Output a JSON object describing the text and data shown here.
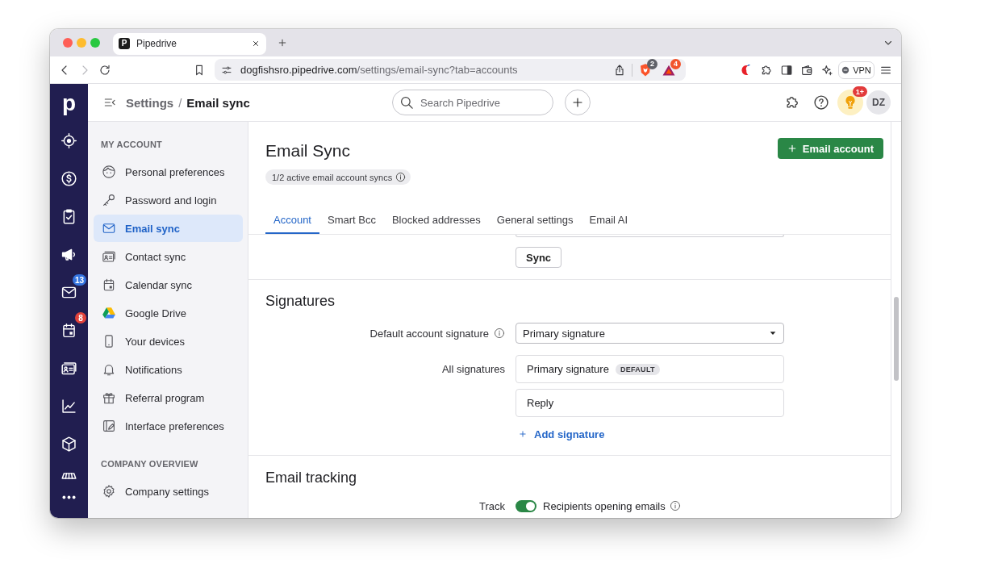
{
  "browser": {
    "tab": {
      "favicon": "P",
      "title": "Pipedrive"
    },
    "nav_buttons": [
      {
        "kind": "back",
        "disabled": false
      },
      {
        "kind": "forward",
        "disabled": true
      },
      {
        "kind": "reload",
        "disabled": false
      }
    ],
    "address": {
      "domain": "dogfishsro.pipedrive.com",
      "path": "/settings/email-sync?tab=accounts"
    },
    "extensions": [
      {
        "kind": "shield",
        "badge": "2",
        "color": "#5f6168"
      },
      {
        "kind": "triangle",
        "badge": "4",
        "color": "#f2542d"
      }
    ],
    "vpn": {
      "label": "VPN"
    }
  },
  "nav": {
    "logo": "p",
    "items": [
      {
        "kind": "target"
      },
      {
        "kind": "dollar"
      },
      {
        "kind": "clipboard"
      },
      {
        "kind": "megaphone"
      },
      {
        "kind": "mail",
        "badge": {
          "text": "13",
          "color": "#3474e0"
        }
      },
      {
        "kind": "calendar",
        "badge": {
          "text": "8",
          "color": "#e2433b"
        }
      },
      {
        "kind": "contacts"
      },
      {
        "kind": "chart"
      },
      {
        "kind": "box"
      }
    ],
    "footer_items": [
      {
        "kind": "store"
      },
      {
        "kind": "more"
      }
    ]
  },
  "header": {
    "breadcrumb": {
      "parent": "Settings",
      "separator": "/",
      "current": "Email sync"
    },
    "search": {
      "placeholder": "Search Pipedrive"
    },
    "tips_badge": "1+",
    "avatar": "DZ"
  },
  "sidebar": {
    "sections": [
      {
        "heading": "MY ACCOUNT",
        "items": [
          {
            "label": "Personal preferences",
            "kind": "face",
            "selected": false
          },
          {
            "label": "Password and login",
            "kind": "key",
            "selected": false
          },
          {
            "label": "Email sync",
            "kind": "mail",
            "selected": true
          },
          {
            "label": "Contact sync",
            "kind": "contacts",
            "selected": false
          },
          {
            "label": "Calendar sync",
            "kind": "calendar",
            "selected": false
          },
          {
            "label": "Google Drive",
            "kind": "drive",
            "selected": false
          },
          {
            "label": "Your devices",
            "kind": "phone",
            "selected": false
          },
          {
            "label": "Notifications",
            "kind": "bell",
            "selected": false
          },
          {
            "label": "Referral program",
            "kind": "gift",
            "selected": false
          },
          {
            "label": "Interface preferences",
            "kind": "interface",
            "selected": false
          }
        ]
      },
      {
        "heading": "COMPANY OVERVIEW",
        "items": [
          {
            "label": "Company settings",
            "kind": "gear",
            "selected": false
          }
        ]
      }
    ]
  },
  "page": {
    "title": "Email Sync",
    "status": "1/2 active email account syncs",
    "primary_button": "Email account",
    "tabs": [
      {
        "label": "Account",
        "selected": true
      },
      {
        "label": "Smart Bcc",
        "selected": false
      },
      {
        "label": "Blocked addresses",
        "selected": false
      },
      {
        "label": "General settings",
        "selected": false
      },
      {
        "label": "Email AI",
        "selected": false
      }
    ],
    "sync_button": "Sync",
    "signatures": {
      "heading": "Signatures",
      "default_label": "Default account signature",
      "default_value": "Primary signature",
      "list_label": "All signatures",
      "items": [
        {
          "name": "Primary signature",
          "tag": "DEFAULT"
        },
        {
          "name": "Reply"
        }
      ],
      "add_link": "Add signature"
    },
    "tracking": {
      "heading": "Email tracking",
      "label": "Track",
      "toggles": [
        {
          "label": "Recipients opening emails",
          "on": true
        }
      ]
    }
  }
}
